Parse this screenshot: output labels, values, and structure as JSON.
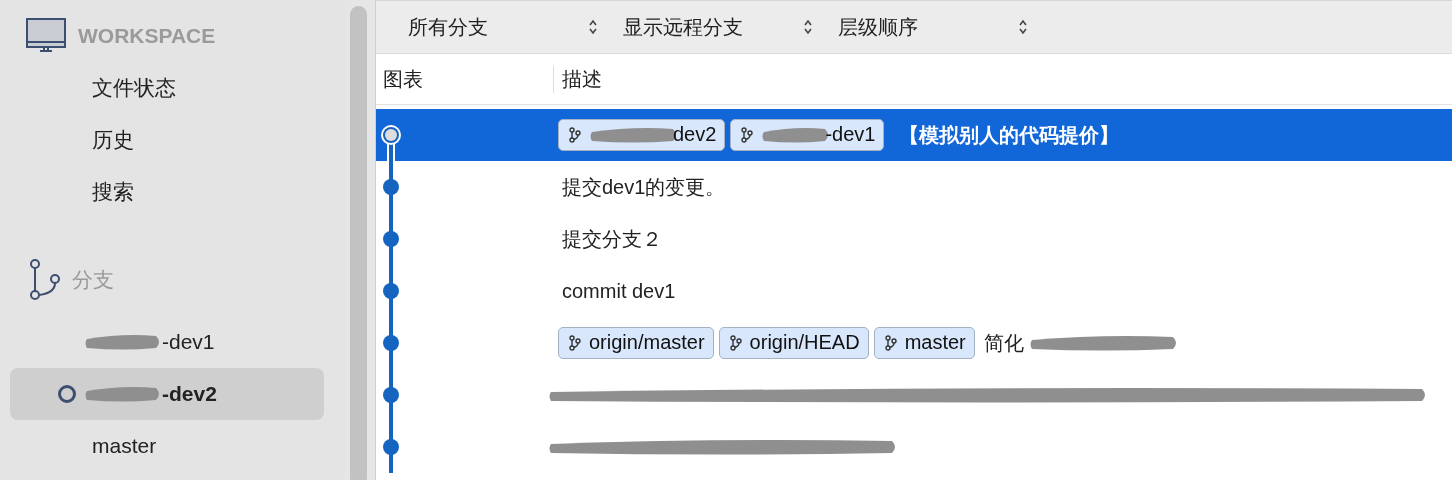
{
  "sidebar": {
    "workspace": {
      "title": "WORKSPACE",
      "items": [
        {
          "label": "文件状态",
          "selected": false
        },
        {
          "label": "历史",
          "selected": false
        },
        {
          "label": "搜索",
          "selected": false
        }
      ]
    },
    "branches": {
      "title": "分支",
      "items": [
        {
          "label": "-dev1",
          "redacted": true,
          "current": false,
          "selected": false
        },
        {
          "label": "-dev2",
          "redacted": true,
          "current": true,
          "selected": true
        },
        {
          "label": "master",
          "redacted": false,
          "current": false,
          "selected": false
        }
      ]
    }
  },
  "toolbar": {
    "dropdowns": [
      "所有分支",
      "显示远程分支",
      "层级顺序"
    ]
  },
  "table": {
    "columns": [
      "图表",
      "描述"
    ],
    "rows": [
      {
        "selected": true,
        "kind": "head",
        "tags": [
          {
            "label": "dev2",
            "redacted": true
          },
          {
            "label": "-dev1",
            "redacted": true
          }
        ],
        "text": "【模拟别人的代码提价】",
        "redacted_after": false
      },
      {
        "selected": false,
        "kind": "commit",
        "text": "提交dev1的变更。",
        "redacted_after": false
      },
      {
        "selected": false,
        "kind": "commit",
        "text": "提交分支２",
        "redacted_after": false
      },
      {
        "selected": false,
        "kind": "commit",
        "text": "commit dev1",
        "redacted_after": false
      },
      {
        "selected": false,
        "kind": "commit",
        "tags": [
          {
            "label": "origin/master",
            "redacted": false
          },
          {
            "label": "origin/HEAD",
            "redacted": false
          },
          {
            "label": "master",
            "redacted": false
          }
        ],
        "text": "简化",
        "redacted_after": true
      },
      {
        "selected": false,
        "kind": "commit",
        "redacted_after": true,
        "redacted_long": true
      },
      {
        "selected": false,
        "kind": "commit",
        "redacted_after": true
      }
    ]
  }
}
